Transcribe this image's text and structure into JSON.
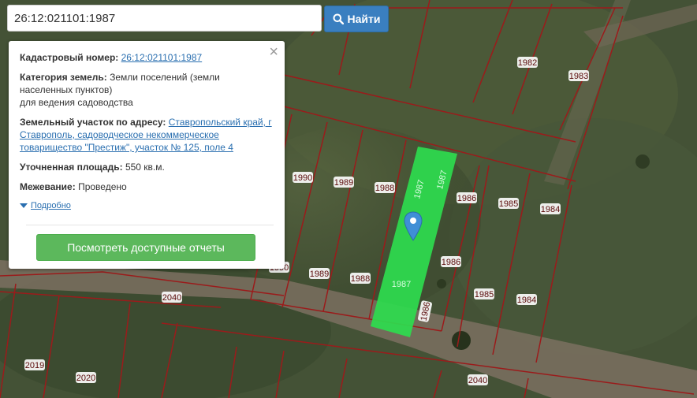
{
  "search": {
    "value": "26:12:021101:1987",
    "button_label": "Найти"
  },
  "popup": {
    "cadastral_label": "Кадастровый номер:",
    "cadastral_value": "26:12:021101:1987",
    "category_label": "Категория земель:",
    "category_value_1": "Земли поселений (земли",
    "category_value_2": "населенных пунктов)",
    "category_value_3": "для ведения садоводства",
    "address_label": "Земельный участок по адресу:",
    "address_value_1": "Ставропольский край, г",
    "address_value_2": "Ставрополь, садоводческое некоммерческое",
    "address_value_3": "товарищество \"Престиж\", участок № 125, поле 4",
    "area_label": "Уточненная площадь:",
    "area_value": "550 кв.м.",
    "survey_label": "Межевание:",
    "survey_value": "Проведено",
    "details_link": "Подробно",
    "reports_button": "Посмотреть доступные отчеты"
  },
  "map": {
    "plot_labels": {
      "p1982": "1982",
      "p1983": "1983",
      "p1990": "1990",
      "p1989a": "1989",
      "p1988a": "1988",
      "p1987a": "1987",
      "p1987b": "1987",
      "p1986a": "1986",
      "p1985a": "1985",
      "p1984a": "1984",
      "p1990b": "1990",
      "p1989b": "1989",
      "p1988b": "1988",
      "p1987c": "1987",
      "p1986b": "1986",
      "p1986c": "1986",
      "p1985b": "1985",
      "p1984b": "1984",
      "p2040a": "2040",
      "p2040b": "2040",
      "p2019": "2019",
      "p2020": "2020"
    },
    "colors": {
      "selected_plot": "#2edc4e",
      "boundary": "#9b1b1b",
      "pin": "#3f8fd6"
    }
  }
}
